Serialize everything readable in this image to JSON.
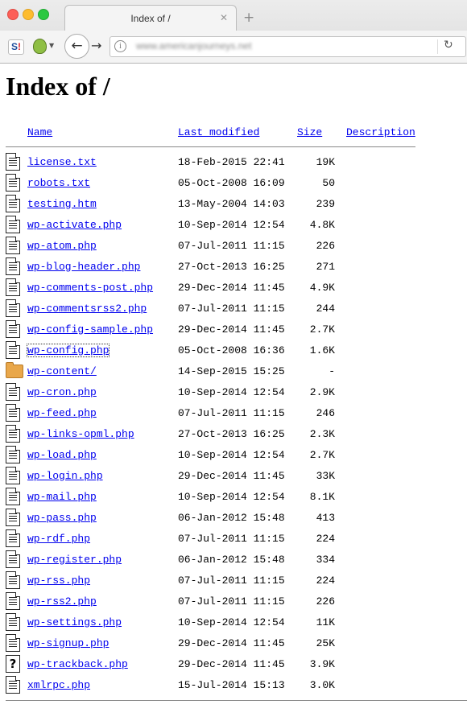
{
  "browser": {
    "tab_title": "Index of /",
    "tab_close": "✕",
    "new_tab": "+",
    "url": "www.americanjourneys.net",
    "sj_logo_left": "S",
    "sj_logo_right": "!",
    "back": "←",
    "forward": "→",
    "info": "i",
    "reload": "↻"
  },
  "page": {
    "title": "Index of /",
    "headers": {
      "name": "Name",
      "modified": "Last modified",
      "size": "Size",
      "description": "Description"
    },
    "entries": [
      {
        "icon": "text-file-icon",
        "name": "license.txt",
        "modified": "18-Feb-2015 22:41",
        "size": "19K"
      },
      {
        "icon": "text-file-icon",
        "name": "robots.txt",
        "modified": "05-Oct-2008 16:09",
        "size": "50"
      },
      {
        "icon": "text-file-icon",
        "name": "testing.htm",
        "modified": "13-May-2004 14:03",
        "size": "239"
      },
      {
        "icon": "text-file-icon",
        "name": "wp-activate.php",
        "modified": "10-Sep-2014 12:54",
        "size": "4.8K"
      },
      {
        "icon": "text-file-icon",
        "name": "wp-atom.php",
        "modified": "07-Jul-2011 11:15",
        "size": "226"
      },
      {
        "icon": "text-file-icon",
        "name": "wp-blog-header.php",
        "modified": "27-Oct-2013 16:25",
        "size": "271"
      },
      {
        "icon": "text-file-icon",
        "name": "wp-comments-post.php",
        "modified": "29-Dec-2014 11:45",
        "size": "4.9K"
      },
      {
        "icon": "text-file-icon",
        "name": "wp-commentsrss2.php",
        "modified": "07-Jul-2011 11:15",
        "size": "244"
      },
      {
        "icon": "text-file-icon",
        "name": "wp-config-sample.php",
        "modified": "29-Dec-2014 11:45",
        "size": "2.7K"
      },
      {
        "icon": "text-file-icon",
        "name": "wp-config.php",
        "modified": "05-Oct-2008 16:36",
        "size": "1.6K"
      },
      {
        "icon": "folder-icon",
        "name": "wp-content/",
        "modified": "14-Sep-2015 15:25",
        "size": "-"
      },
      {
        "icon": "text-file-icon",
        "name": "wp-cron.php",
        "modified": "10-Sep-2014 12:54",
        "size": "2.9K"
      },
      {
        "icon": "text-file-icon",
        "name": "wp-feed.php",
        "modified": "07-Jul-2011 11:15",
        "size": "246"
      },
      {
        "icon": "text-file-icon",
        "name": "wp-links-opml.php",
        "modified": "27-Oct-2013 16:25",
        "size": "2.3K"
      },
      {
        "icon": "text-file-icon",
        "name": "wp-load.php",
        "modified": "10-Sep-2014 12:54",
        "size": "2.7K"
      },
      {
        "icon": "text-file-icon",
        "name": "wp-login.php",
        "modified": "29-Dec-2014 11:45",
        "size": "33K"
      },
      {
        "icon": "text-file-icon",
        "name": "wp-mail.php",
        "modified": "10-Sep-2014 12:54",
        "size": "8.1K"
      },
      {
        "icon": "text-file-icon",
        "name": "wp-pass.php",
        "modified": "06-Jan-2012 15:48",
        "size": "413"
      },
      {
        "icon": "text-file-icon",
        "name": "wp-rdf.php",
        "modified": "07-Jul-2011 11:15",
        "size": "224"
      },
      {
        "icon": "text-file-icon",
        "name": "wp-register.php",
        "modified": "06-Jan-2012 15:48",
        "size": "334"
      },
      {
        "icon": "text-file-icon",
        "name": "wp-rss.php",
        "modified": "07-Jul-2011 11:15",
        "size": "224"
      },
      {
        "icon": "text-file-icon",
        "name": "wp-rss2.php",
        "modified": "07-Jul-2011 11:15",
        "size": "226"
      },
      {
        "icon": "text-file-icon",
        "name": "wp-settings.php",
        "modified": "10-Sep-2014 12:54",
        "size": "11K"
      },
      {
        "icon": "text-file-icon",
        "name": "wp-signup.php",
        "modified": "29-Dec-2014 11:45",
        "size": "25K"
      },
      {
        "icon": "unknown-file-icon",
        "name": "wp-trackback.php",
        "modified": "29-Dec-2014 11:45",
        "size": "3.9K"
      },
      {
        "icon": "text-file-icon",
        "name": "xmlrpc.php",
        "modified": "15-Jul-2014 15:13",
        "size": "3.0K"
      }
    ]
  }
}
